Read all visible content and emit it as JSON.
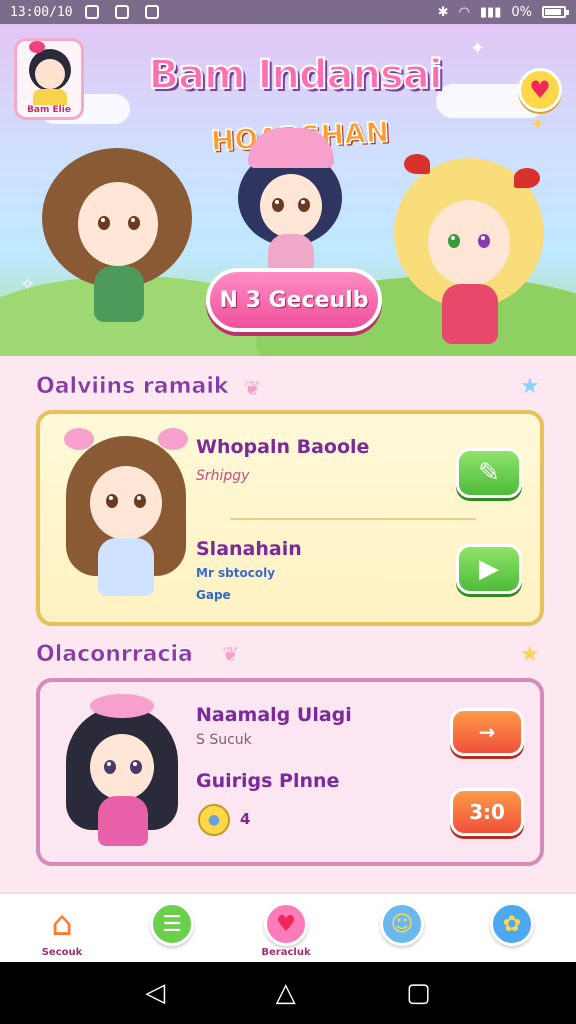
{
  "status_bar": {
    "time": "13:00/10",
    "battery_text": "0%",
    "battery_level": 0.8
  },
  "header": {
    "avatar_label": "Bam Elie",
    "app_title": "Bam Indansai",
    "subtitle": "HOARSHAN",
    "cta_button": "N 3 Geceulb"
  },
  "section1": {
    "title": "Oalviins ramaik",
    "item1_title": "Whopaln Baoole",
    "item1_sub": "Srhipgy",
    "item2_title": "Slanahain",
    "item2_tag1": "Mr sbtocoly",
    "item2_tag2": "Gape"
  },
  "section2": {
    "title": "Olaconrracia",
    "item1_title": "Naamalg Ulagi",
    "item1_sub": "S Sucuk",
    "item2_title": "Guirigs Plnne",
    "item2_count": "4",
    "button1_label": "→",
    "button2_label": "3:0"
  },
  "bottom_nav": [
    {
      "label": "Secouk",
      "icon": "home-icon"
    },
    {
      "label": "",
      "icon": "list-icon"
    },
    {
      "label": "Beracluk",
      "icon": "heart-icon"
    },
    {
      "label": "",
      "icon": "character-icon"
    },
    {
      "label": "",
      "icon": "gift-icon"
    }
  ],
  "colors": {
    "accent_pink": "#f0509c",
    "accent_green": "#4fbb3a",
    "accent_orange": "#f0503a",
    "title_purple": "#8a3aa8"
  }
}
